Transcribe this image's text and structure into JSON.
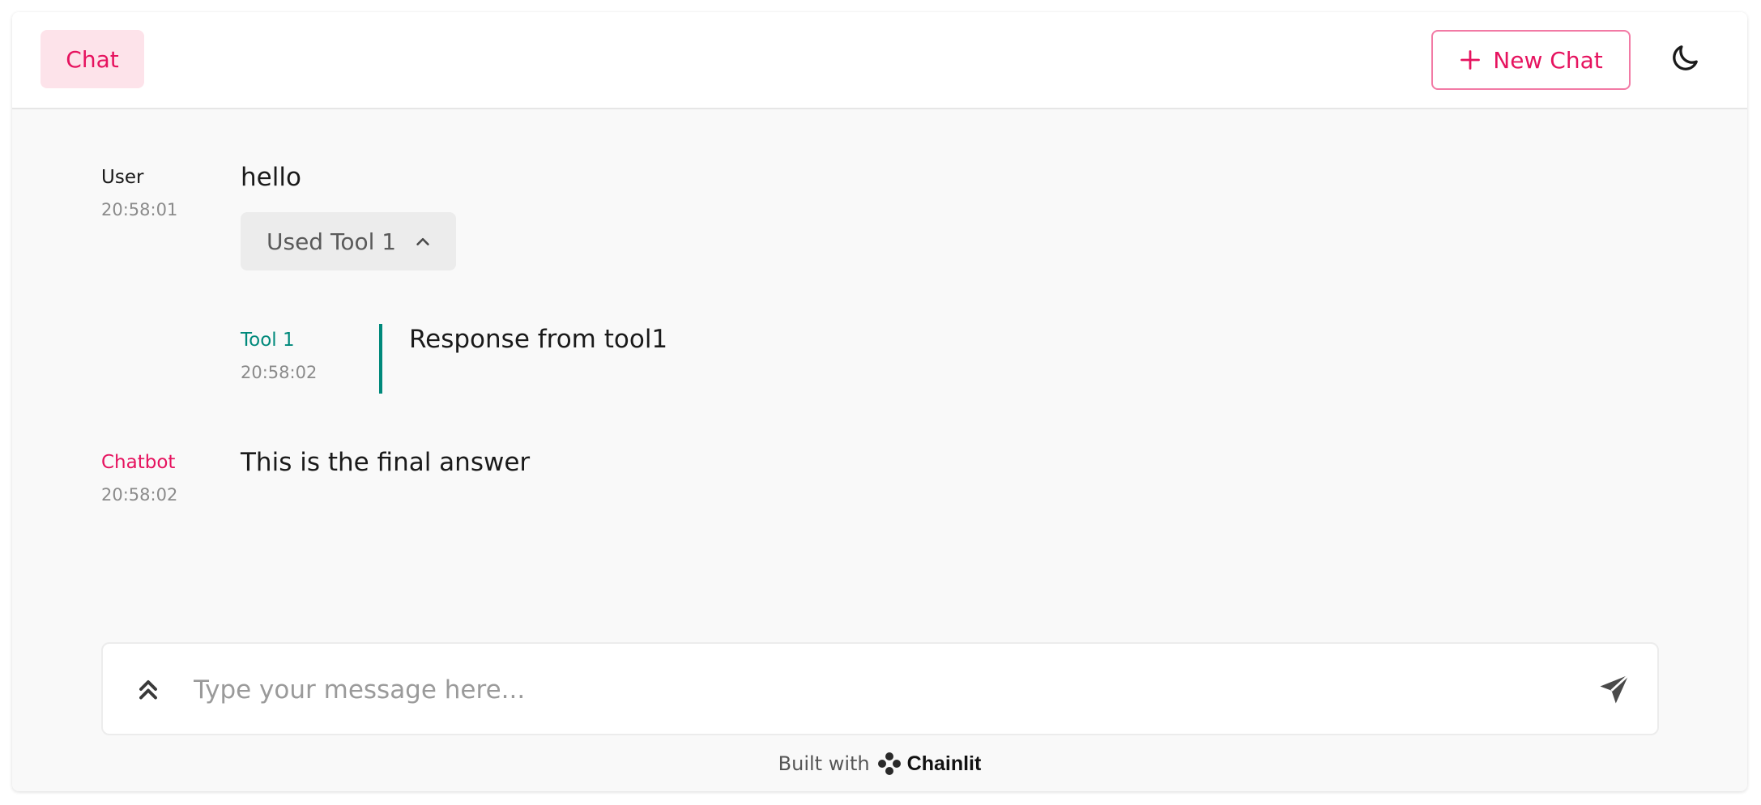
{
  "header": {
    "tab_label": "Chat",
    "new_chat_label": "New Chat",
    "theme_icon": "moon-icon"
  },
  "messages": [
    {
      "author": "User",
      "time": "20:58:01",
      "text": "hello"
    },
    {
      "author": "Tool 1",
      "time": "20:58:02",
      "text": "Response from tool1"
    },
    {
      "author": "Chatbot",
      "time": "20:58:02",
      "text": "This is the final answer"
    }
  ],
  "tool_toggle": {
    "label": "Used Tool 1",
    "icon": "chevron-up-icon"
  },
  "composer": {
    "placeholder": "Type your message here...",
    "expand_icon": "chevrons-up-icon",
    "send_icon": "send-icon"
  },
  "footer": {
    "built_with": "Built with",
    "brand": "Chainlit"
  },
  "colors": {
    "accent": "#e6135f",
    "accent_light": "#fde3ea",
    "tool": "#00897b",
    "background": "#f9f9f9"
  }
}
